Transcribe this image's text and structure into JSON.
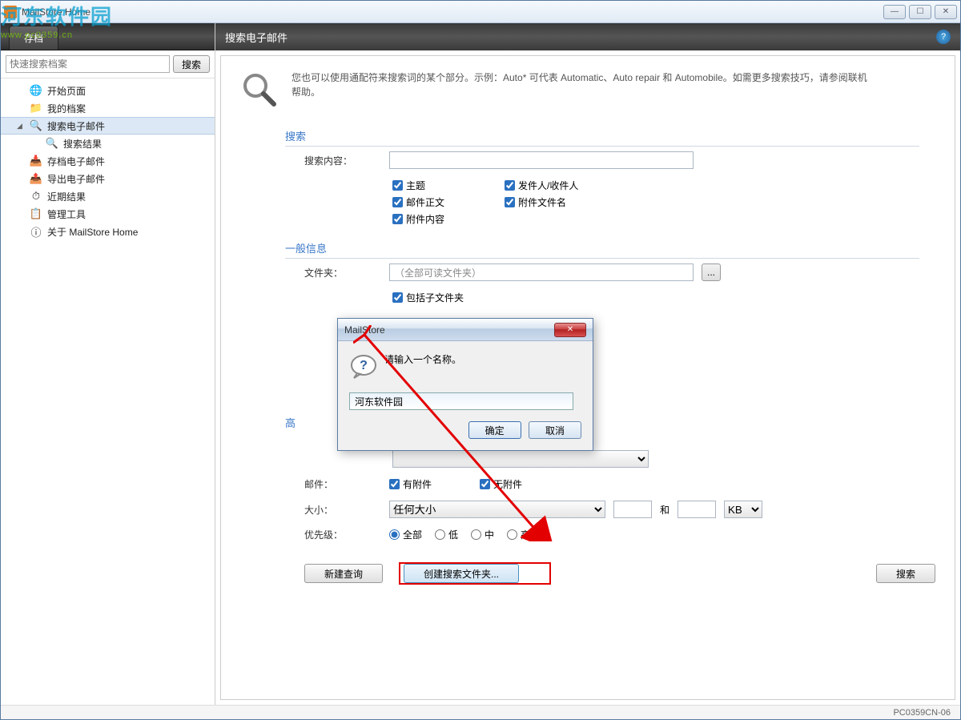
{
  "window": {
    "title": "MailStore Home"
  },
  "logo": {
    "main": "河东软件园",
    "sub": "www.pc0359.cn"
  },
  "sidebar": {
    "tab": "存档",
    "search_placeholder": "快速搜索档案",
    "search_btn": "搜索",
    "items": [
      {
        "label": "开始页面",
        "icon": "🌐",
        "color": "#3aa030"
      },
      {
        "label": "我的档案",
        "icon": "📁",
        "color": "#d9a63c"
      },
      {
        "label": "搜索电子邮件",
        "icon": "🔍",
        "color": "#5a8bc0",
        "selected": true,
        "expand": true
      },
      {
        "label": "搜索结果",
        "icon": "🔍",
        "color": "#5a8bc0",
        "indent": 3
      },
      {
        "label": "存档电子邮件",
        "icon": "📥",
        "color": "#d04040"
      },
      {
        "label": "导出电子邮件",
        "icon": "📤",
        "color": "#3a8a3a"
      },
      {
        "label": "近期结果",
        "icon": "⏱",
        "color": "#3060b0"
      },
      {
        "label": "管理工具",
        "icon": "📋",
        "color": "#7080a0"
      },
      {
        "label": "关于 MailStore Home",
        "icon": "ⓘ",
        "color": "#3080c8"
      }
    ]
  },
  "content": {
    "header": "搜索电子邮件",
    "hint": "您也可以使用通配符来搜索词的某个部分。示例：Auto* 可代表 Automatic、Auto repair 和 Automobile。如需更多搜索技巧，请参阅联机帮助。",
    "section_search": "搜索",
    "label_content": "搜索内容：",
    "cb_subject": "主题",
    "cb_sender": "发件人/收件人",
    "cb_body": "邮件正文",
    "cb_attach_name": "附件文件名",
    "cb_attach_content": "附件内容",
    "section_general": "一般信息",
    "label_folder": "文件夹：",
    "folder_placeholder": "（全部可读文件夹）",
    "cb_subfolders": "包括子文件夹",
    "section_adv_char": "高",
    "label_mail": "邮件：",
    "cb_has_attach": "有附件",
    "cb_no_attach": "无附件",
    "label_size": "大小：",
    "size_any": "任何大小",
    "size_and": "和",
    "size_unit": "KB",
    "label_priority": "优先级：",
    "prio_all": "全部",
    "prio_low": "低",
    "prio_mid": "中",
    "prio_high": "高",
    "btn_new": "新建查询",
    "btn_create_folder": "创建搜索文件夹...",
    "btn_search": "搜索"
  },
  "dialog": {
    "title": "MailStore",
    "prompt": "请输入一个名称。",
    "value": "河东软件园",
    "ok": "确定",
    "cancel": "取消"
  },
  "status": "PC0359CN-06"
}
